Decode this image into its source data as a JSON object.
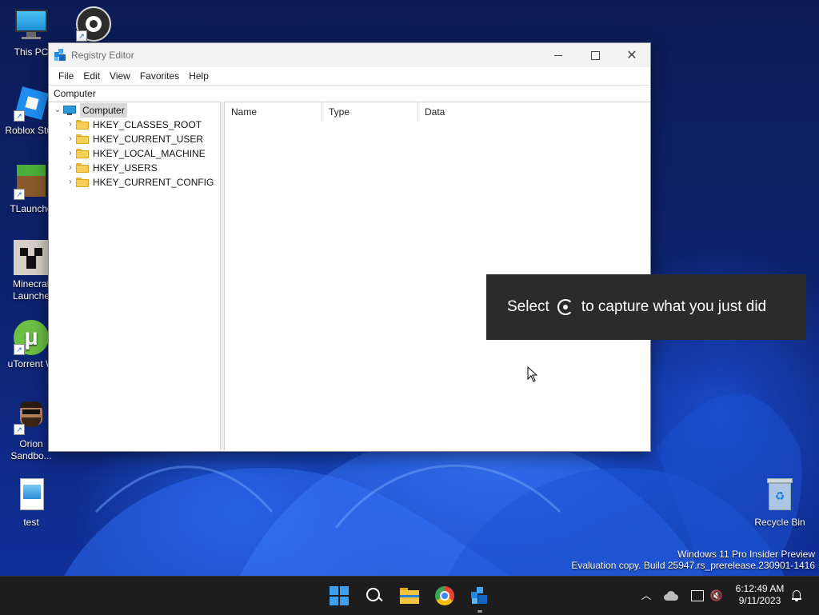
{
  "desktop": {
    "icons": [
      {
        "label": "This PC"
      },
      {
        "label": "Roblox Stud"
      },
      {
        "label": "TLaunche"
      },
      {
        "label": "Minecraf"
      },
      {
        "label": "Launche"
      },
      {
        "label": "uTorrent W"
      },
      {
        "label": "Orion"
      },
      {
        "label": "Sandbo..."
      },
      {
        "label": "test"
      },
      {
        "label": "Recycle Bin"
      }
    ],
    "watermark": {
      "line1": "Windows 11 Pro Insider Preview",
      "line2": "Evaluation copy. Build 25947.rs_prerelease.230901-1416"
    }
  },
  "window": {
    "title": "Registry Editor",
    "menu": [
      "File",
      "Edit",
      "View",
      "Favorites",
      "Help"
    ],
    "address": "Computer",
    "tree": {
      "root": "Computer",
      "children": [
        "HKEY_CLASSES_ROOT",
        "HKEY_CURRENT_USER",
        "HKEY_LOCAL_MACHINE",
        "HKEY_USERS",
        "HKEY_CURRENT_CONFIG"
      ]
    },
    "columns": [
      "Name",
      "Type",
      "Data"
    ]
  },
  "toast": {
    "before": "Select",
    "after": "to capture what you just did"
  },
  "taskbar": {
    "time": "6:12:49 AM",
    "date": "9/11/2023"
  }
}
